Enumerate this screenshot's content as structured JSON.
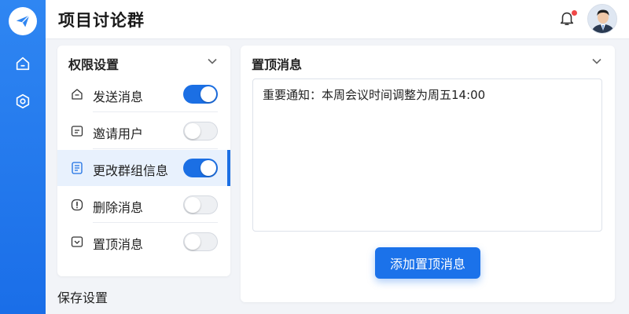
{
  "header": {
    "title": "项目讨论群",
    "notification_dot_color": "#f04848"
  },
  "rail": {
    "logo_icon": "paper-plane-icon",
    "items": [
      {
        "name": "home",
        "icon": "home-icon"
      },
      {
        "name": "settings",
        "icon": "settings-hexagon-icon"
      }
    ]
  },
  "permissions": {
    "title": "权限设置",
    "items": [
      {
        "label": "发送消息",
        "icon": "send-icon",
        "enabled": true,
        "selected": false
      },
      {
        "label": "邀请用户",
        "icon": "invite-icon",
        "enabled": false,
        "selected": false
      },
      {
        "label": "更改群组信息",
        "icon": "document-icon",
        "enabled": true,
        "selected": true
      },
      {
        "label": "删除消息",
        "icon": "alert-icon",
        "enabled": false,
        "selected": false
      },
      {
        "label": "置顶消息",
        "icon": "pin-icon",
        "enabled": false,
        "selected": false
      }
    ]
  },
  "save_label": "保存设置",
  "pinned": {
    "title": "置顶消息",
    "text": "重要通知：本周会议时间调整为周五14:00",
    "add_button": "添加置顶消息"
  },
  "colors": {
    "accent": "#1b6fe4",
    "rail": "#2f86f2",
    "selected_row": "#e8f1fd"
  }
}
